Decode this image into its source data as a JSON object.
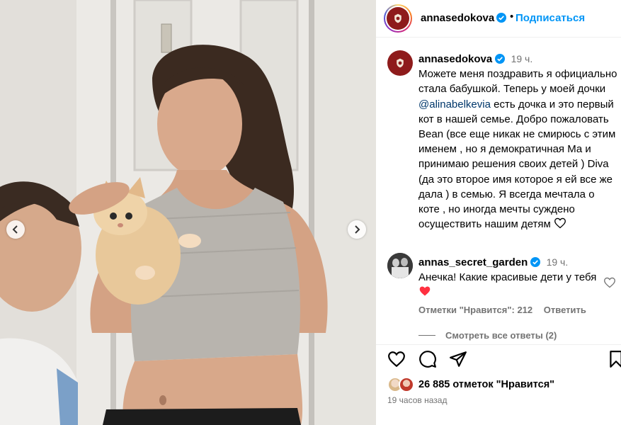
{
  "header": {
    "username": "annasedokova",
    "follow_label": "Подписаться"
  },
  "caption": {
    "username": "annasedokova",
    "time": "19 ч.",
    "text_before_mention": "Можете меня поздравить я официально стала бабушкой. Теперь у моей дочки ",
    "mention": "@alinabelkevia",
    "text_after_mention": " есть дочка и это первый кот в нашей семье. Добро пожаловать Bean (все еще никак не смирюсь с этим именем , но я демократичная Ма и принимаю решения своих детей ) Diva (да это второе имя которое я ей все же дала ) в семью. Я всегда мечтала о коте , но иногда мечты суждено осуществить нашим детям"
  },
  "comment": {
    "username": "annas_secret_garden",
    "time": "19 ч.",
    "text": "Анечка! Какие красивые дети у тебя",
    "likes_label": "Отметки \"Нравится\": 212",
    "reply_label": "Ответить",
    "view_replies": "Смотреть все ответы (2)"
  },
  "footer": {
    "likes": "26 885 отметок \"Нравится\"",
    "time_ago": "19 часов назад"
  },
  "colors": {
    "link": "#0095f6",
    "mention": "#00376b",
    "muted": "#737373",
    "heart_red": "#ff3040",
    "verified": "#0095f6"
  },
  "icons": [
    "chevron-left-icon",
    "chevron-right-icon",
    "verified-icon",
    "heart-icon",
    "comment-icon",
    "share-icon",
    "bookmark-icon"
  ]
}
